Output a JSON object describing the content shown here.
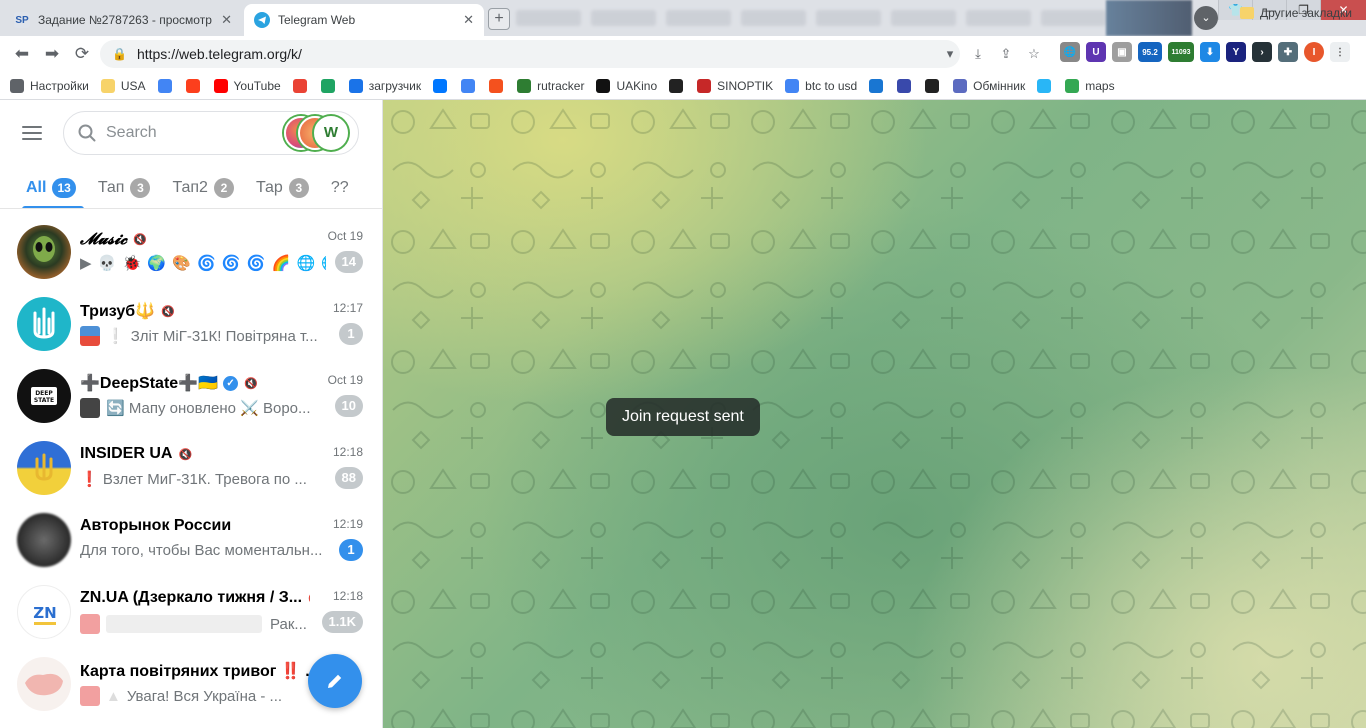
{
  "browser": {
    "tabs": [
      {
        "favicon_text": "SP",
        "title": "Задание №2787263 - просмотр з",
        "active": false
      },
      {
        "favicon_text": "",
        "title": "Telegram Web",
        "active": true
      }
    ],
    "url": "https://web.telegram.org/k/",
    "extension_badges": {
      "temp": "95.2",
      "counter": "11093"
    },
    "profile_initial": "I",
    "bookmarks": [
      {
        "label": "Настройки",
        "icon": "gear-icon",
        "color": "#5f6368"
      },
      {
        "label": "USA",
        "icon": "folder-icon",
        "color": "#f7d36a"
      },
      {
        "label": "",
        "icon": "google-icon",
        "color": "#4285f4"
      },
      {
        "label": "",
        "icon": "yandex-icon",
        "color": "#fc3f1d"
      },
      {
        "label": "YouTube",
        "icon": "youtube-icon",
        "color": "#ff0000"
      },
      {
        "label": "",
        "icon": "gmail-icon",
        "color": "#ea4335"
      },
      {
        "label": "",
        "icon": "drive-icon",
        "color": "#1fa463"
      },
      {
        "label": "загрузчик",
        "icon": "infinity-icon",
        "color": "#1a73e8"
      },
      {
        "label": "",
        "icon": "vk-icon",
        "color": "#0077ff"
      },
      {
        "label": "",
        "icon": "translate-icon",
        "color": "#4285f4"
      },
      {
        "label": "",
        "icon": "f-icon",
        "color": "#f4511e"
      },
      {
        "label": "rutracker",
        "icon": "rutracker-icon",
        "color": "#2e7d32"
      },
      {
        "label": "UAKino",
        "icon": "uakino-icon",
        "color": "#111111"
      },
      {
        "label": "",
        "icon": "chess-icon",
        "color": "#222222"
      },
      {
        "label": "SINOPTIK",
        "icon": "thermometer-icon",
        "color": "#c62828"
      },
      {
        "label": "btc to usd",
        "icon": "google-icon",
        "color": "#4285f4"
      },
      {
        "label": "",
        "icon": "p-icon",
        "color": "#1976d2"
      },
      {
        "label": "",
        "icon": "arrow-icon",
        "color": "#3949ab"
      },
      {
        "label": "",
        "icon": "bc-icon",
        "color": "#222222"
      },
      {
        "label": "Обмінник",
        "icon": "exchange-icon",
        "color": "#5c6bc0"
      },
      {
        "label": "",
        "icon": "star-icon",
        "color": "#29b6f6"
      },
      {
        "label": "maps",
        "icon": "maps-icon",
        "color": "#34a853"
      }
    ],
    "bookmarks_more": "»",
    "other_bookmarks": "Другие закладки"
  },
  "telegram": {
    "search_placeholder": "Search",
    "folders": [
      {
        "label": "All",
        "count": "13",
        "active": true
      },
      {
        "label": "Тап",
        "count": "3",
        "active": false
      },
      {
        "label": "Тап2",
        "count": "2",
        "active": false
      },
      {
        "label": "Тар",
        "count": "3",
        "active": false
      },
      {
        "label": "??",
        "count": "",
        "active": false
      }
    ],
    "chats": [
      {
        "name": "𝓜𝓾𝓼𝓲𝓬",
        "muted": true,
        "time": "Oct 19",
        "message": "▶ 💀 🐞 🌍 🎨 🌀 🌀 🌀 🌈 🌐 🌐",
        "unread": "14",
        "unread_style": "muted"
      },
      {
        "name": "Тризуб🔱",
        "muted": true,
        "time": "12:17",
        "message": "Зліт МіГ-31К! Повітряна т...",
        "unread": "1",
        "unread_style": "muted"
      },
      {
        "name": "➕DeepState➕🇺🇦",
        "muted": true,
        "verified": true,
        "time": "Oct 19",
        "message": "🔄 Мапу оновлено ⚔️ Воро...",
        "unread": "10",
        "unread_style": "muted"
      },
      {
        "name": "INSIDER UA",
        "muted": true,
        "time": "12:18",
        "message": "❗ Взлет МиГ-31К. Тревога по ...",
        "unread": "88",
        "unread_style": "muted"
      },
      {
        "name": "Авторынок России",
        "muted": false,
        "time": "12:19",
        "message": "Для того, чтобы Вас моментальн...",
        "unread": "1",
        "unread_style": "blue"
      },
      {
        "name": "ZN.UA (Дзеркало тижня / З...",
        "muted": true,
        "time": "12:18",
        "message": "Рак...",
        "unread": "1.1K",
        "unread_style": "muted"
      },
      {
        "name": "Карта повітряних тривог ‼️ ...",
        "muted": false,
        "time": "",
        "message": "Увага! Вся Україна - ...",
        "unread": "",
        "unread_style": "muted"
      }
    ],
    "toast": "Join request sent",
    "colors": {
      "accent": "#3390ec",
      "muted_badge": "#c4c9cc"
    }
  }
}
